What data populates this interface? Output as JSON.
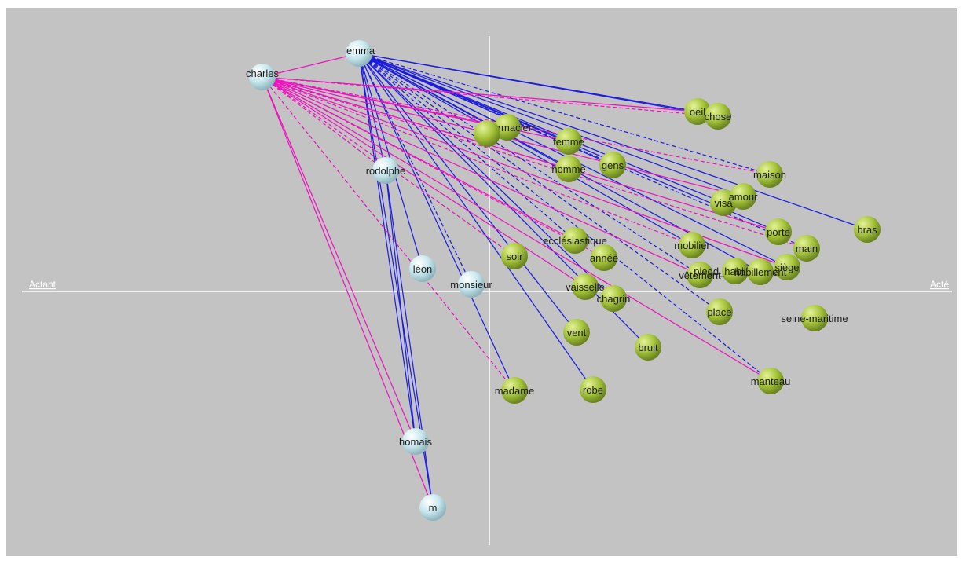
{
  "axis": {
    "left_label": "Actant",
    "right_label": "Acté"
  },
  "colors": {
    "background": "#c3c3c3",
    "actant_node": "#c8e8ee",
    "acte_node": "#a6c43a",
    "edge_blue": "#1a1ae0",
    "edge_magenta": "#ee10c0",
    "axis": "#ffffff"
  },
  "actants": [
    {
      "id": "emma",
      "label": "emma"
    },
    {
      "id": "charles",
      "label": "charles"
    },
    {
      "id": "rodolphe",
      "label": "rodolphe"
    },
    {
      "id": "leon",
      "label": "léon"
    },
    {
      "id": "monsieur",
      "label": "monsieur"
    },
    {
      "id": "homais",
      "label": "homais"
    },
    {
      "id": "m",
      "label": "m"
    }
  ],
  "actes": [
    {
      "id": "oeil",
      "label": "oeil"
    },
    {
      "id": "chose",
      "label": "chose"
    },
    {
      "id": "pharmacien_a",
      "label": "pharmacien"
    },
    {
      "id": "pharmacien_b",
      "label": ""
    },
    {
      "id": "femme",
      "label": "femme"
    },
    {
      "id": "homme",
      "label": "homme"
    },
    {
      "id": "gens",
      "label": "gens"
    },
    {
      "id": "maison",
      "label": "maison"
    },
    {
      "id": "visage",
      "label": "visa"
    },
    {
      "id": "amour",
      "label": "amour"
    },
    {
      "id": "bras",
      "label": "bras"
    },
    {
      "id": "porte",
      "label": "porte"
    },
    {
      "id": "main",
      "label": "main"
    },
    {
      "id": "mobilier",
      "label": "mobilier"
    },
    {
      "id": "ecclesiastique",
      "label": "ecclésiastique"
    },
    {
      "id": "annee",
      "label": "année"
    },
    {
      "id": "soir",
      "label": "soir"
    },
    {
      "id": "vetement",
      "label": "vêtement"
    },
    {
      "id": "pied",
      "label": "piedd_habillement"
    },
    {
      "id": "siege",
      "label": "siège"
    },
    {
      "id": "habillement",
      "label": "habillement"
    },
    {
      "id": "vaisselle",
      "label": "vaisselle"
    },
    {
      "id": "chagrin",
      "label": "chagrin"
    },
    {
      "id": "place",
      "label": "place"
    },
    {
      "id": "seine_maritime",
      "label": "seine-maritime"
    },
    {
      "id": "vent",
      "label": "vent"
    },
    {
      "id": "bruit",
      "label": "bruit"
    },
    {
      "id": "manteau",
      "label": "manteau"
    },
    {
      "id": "madame",
      "label": "madame"
    },
    {
      "id": "robe",
      "label": "robe"
    }
  ],
  "edges": [
    {
      "from": "emma",
      "to": "oeil",
      "color": "blue",
      "dashed": false
    },
    {
      "from": "emma",
      "to": "chose",
      "color": "blue",
      "dashed": false
    },
    {
      "from": "emma",
      "to": "pharmacien_a",
      "color": "blue",
      "dashed": false
    },
    {
      "from": "emma",
      "to": "femme",
      "color": "blue",
      "dashed": false
    },
    {
      "from": "emma",
      "to": "homme",
      "color": "blue",
      "dashed": false
    },
    {
      "from": "emma",
      "to": "gens",
      "color": "blue",
      "dashed": false
    },
    {
      "from": "emma",
      "to": "maison",
      "color": "blue",
      "dashed": true
    },
    {
      "from": "emma",
      "to": "visage",
      "color": "blue",
      "dashed": false
    },
    {
      "from": "emma",
      "to": "amour",
      "color": "blue",
      "dashed": false
    },
    {
      "from": "emma",
      "to": "bras",
      "color": "blue",
      "dashed": false
    },
    {
      "from": "emma",
      "to": "porte",
      "color": "blue",
      "dashed": false
    },
    {
      "from": "emma",
      "to": "main",
      "color": "blue",
      "dashed": true
    },
    {
      "from": "emma",
      "to": "mobilier",
      "color": "blue",
      "dashed": false
    },
    {
      "from": "emma",
      "to": "siege",
      "color": "blue",
      "dashed": false
    },
    {
      "from": "emma",
      "to": "habillement",
      "color": "blue",
      "dashed": false
    },
    {
      "from": "emma",
      "to": "vetement",
      "color": "blue",
      "dashed": true
    },
    {
      "from": "emma",
      "to": "place",
      "color": "blue",
      "dashed": true
    },
    {
      "from": "emma",
      "to": "manteau",
      "color": "blue",
      "dashed": true
    },
    {
      "from": "emma",
      "to": "chagrin",
      "color": "blue",
      "dashed": false
    },
    {
      "from": "emma",
      "to": "bruit",
      "color": "blue",
      "dashed": false
    },
    {
      "from": "emma",
      "to": "vent",
      "color": "blue",
      "dashed": false
    },
    {
      "from": "emma",
      "to": "robe",
      "color": "blue",
      "dashed": false
    },
    {
      "from": "emma",
      "to": "madame",
      "color": "blue",
      "dashed": false
    },
    {
      "from": "emma",
      "to": "monsieur",
      "color": "blue",
      "dashed": true
    },
    {
      "from": "emma",
      "to": "leon",
      "color": "blue",
      "dashed": false
    },
    {
      "from": "emma",
      "to": "rodolphe",
      "color": "blue",
      "dashed": false
    },
    {
      "from": "emma",
      "to": "homais",
      "color": "blue",
      "dashed": false
    },
    {
      "from": "emma",
      "to": "m",
      "color": "blue",
      "dashed": false
    },
    {
      "from": "emma",
      "to": "ecclesiastique",
      "color": "blue",
      "dashed": true
    },
    {
      "from": "emma",
      "to": "charles",
      "color": "magenta",
      "dashed": false
    },
    {
      "from": "charles",
      "to": "oeil",
      "color": "magenta",
      "dashed": false
    },
    {
      "from": "charles",
      "to": "chose",
      "color": "magenta",
      "dashed": true
    },
    {
      "from": "charles",
      "to": "pharmacien_a",
      "color": "magenta",
      "dashed": false
    },
    {
      "from": "charles",
      "to": "femme",
      "color": "magenta",
      "dashed": false
    },
    {
      "from": "charles",
      "to": "homme",
      "color": "magenta",
      "dashed": false
    },
    {
      "from": "charles",
      "to": "maison",
      "color": "magenta",
      "dashed": true
    },
    {
      "from": "charles",
      "to": "amour",
      "color": "magenta",
      "dashed": false
    },
    {
      "from": "charles",
      "to": "porte",
      "color": "magenta",
      "dashed": false
    },
    {
      "from": "charles",
      "to": "main",
      "color": "magenta",
      "dashed": true
    },
    {
      "from": "charles",
      "to": "siege",
      "color": "magenta",
      "dashed": false
    },
    {
      "from": "charles",
      "to": "mobilier",
      "color": "magenta",
      "dashed": true
    },
    {
      "from": "charles",
      "to": "vetement",
      "color": "magenta",
      "dashed": false
    },
    {
      "from": "charles",
      "to": "ecclesiastique",
      "color": "magenta",
      "dashed": false
    },
    {
      "from": "charles",
      "to": "annee",
      "color": "magenta",
      "dashed": true
    },
    {
      "from": "charles",
      "to": "vaisselle",
      "color": "magenta",
      "dashed": false
    },
    {
      "from": "charles",
      "to": "manteau",
      "color": "magenta",
      "dashed": false
    },
    {
      "from": "charles",
      "to": "soir",
      "color": "magenta",
      "dashed": true
    },
    {
      "from": "charles",
      "to": "madame",
      "color": "magenta",
      "dashed": true
    },
    {
      "from": "charles",
      "to": "rodolphe",
      "color": "magenta",
      "dashed": true
    },
    {
      "from": "charles",
      "to": "homais",
      "color": "magenta",
      "dashed": false
    },
    {
      "from": "charles",
      "to": "m",
      "color": "magenta",
      "dashed": false
    },
    {
      "from": "rodolphe",
      "to": "homais",
      "color": "blue",
      "dashed": false
    },
    {
      "from": "rodolphe",
      "to": "m",
      "color": "blue",
      "dashed": false
    }
  ]
}
